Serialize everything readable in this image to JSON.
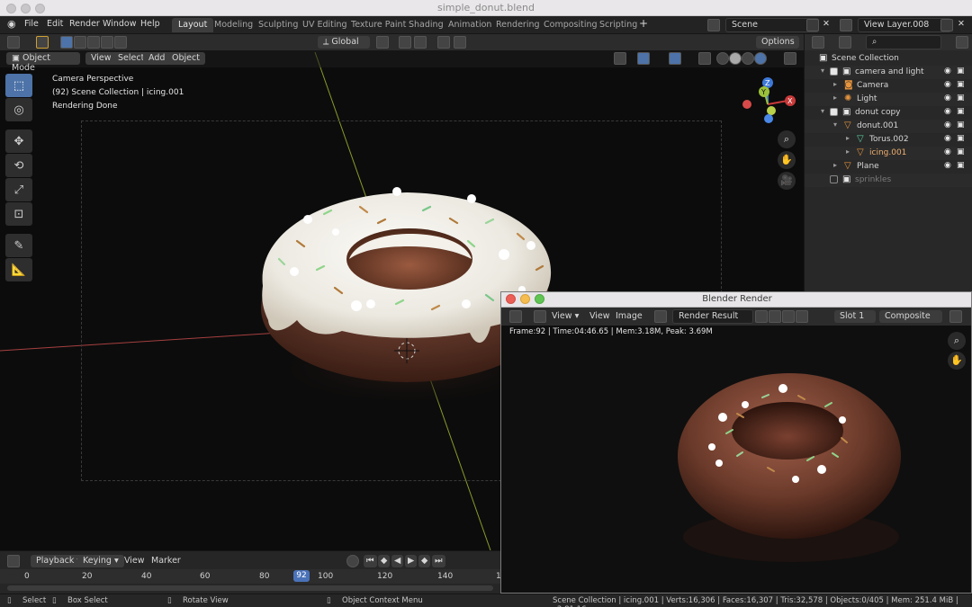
{
  "window": {
    "title": "simple_donut.blend"
  },
  "menu": {
    "items": [
      "File",
      "Edit",
      "Render",
      "Window",
      "Help"
    ]
  },
  "workspaces": [
    "Layout",
    "Modeling",
    "Sculpting",
    "UV Editing",
    "Texture Paint",
    "Shading",
    "Animation",
    "Rendering",
    "Compositing",
    "Scripting"
  ],
  "active_workspace": "Layout",
  "scene": {
    "name": "Scene",
    "view_layer": "View Layer.008"
  },
  "viewport": {
    "mode": "Object Mode",
    "menus": [
      "View",
      "Select",
      "Add",
      "Object"
    ],
    "orientation": "Global",
    "options_label": "Options",
    "info": [
      "Camera Perspective",
      "(92) Scene Collection | icing.001",
      "Rendering Done"
    ],
    "gizmo_axis": {
      "z": "Z",
      "y": "Y",
      "x": "X"
    }
  },
  "outliner": {
    "rows": [
      {
        "label": "Scene Collection",
        "indent": 0,
        "icon": "collection",
        "checkbox": null
      },
      {
        "label": "camera and light",
        "indent": 1,
        "icon": "collection",
        "checkbox": true
      },
      {
        "label": "Camera",
        "indent": 2,
        "icon": "camera",
        "checkbox": null
      },
      {
        "label": "Light",
        "indent": 2,
        "icon": "light",
        "checkbox": null
      },
      {
        "label": "donut copy",
        "indent": 1,
        "icon": "collection",
        "checkbox": true
      },
      {
        "label": "donut.001",
        "indent": 2,
        "icon": "mesh",
        "checkbox": null
      },
      {
        "label": "Torus.002",
        "indent": 3,
        "icon": "mesh-data",
        "checkbox": null
      },
      {
        "label": "icing.001",
        "indent": 3,
        "icon": "mesh",
        "checkbox": null
      },
      {
        "label": "Plane",
        "indent": 2,
        "icon": "mesh",
        "checkbox": null
      },
      {
        "label": "sprinkles",
        "indent": 1,
        "icon": "collection",
        "checkbox": false
      }
    ]
  },
  "timeline": {
    "menus": [
      "Playback",
      "Keying",
      "View",
      "Marker"
    ],
    "ticks": [
      "0",
      "20",
      "40",
      "60",
      "80",
      "100",
      "120",
      "140",
      "1"
    ],
    "current_frame": "92"
  },
  "render_window": {
    "title": "Blender Render",
    "menus": [
      "View",
      "View",
      "Image"
    ],
    "image_name": "Render Result",
    "slot": "Slot 1",
    "pass": "Composite",
    "info": "Frame:92 | Time:04:46.65 | Mem:3.18M, Peak: 3.69M"
  },
  "statusbar": {
    "select": "Select",
    "box_select": "Box Select",
    "rotate": "Rotate View",
    "context": "Object Context Menu",
    "stats": "Scene Collection | icing.001 | Verts:16,306 | Faces:16,307 | Tris:32,578 | Objects:0/405 | Mem: 251.4 MiB | v2.81.16"
  },
  "colors": {
    "accent_blue": "#4d73a8",
    "frame_marker": "#4a72b8",
    "icing": "#f3f1ea",
    "chocolate": "#6b3a2a",
    "object_orange": "#e6953e",
    "x_axis": "#c83a3a",
    "y_axis": "#9bc03a",
    "z_axis": "#3d78d8"
  }
}
